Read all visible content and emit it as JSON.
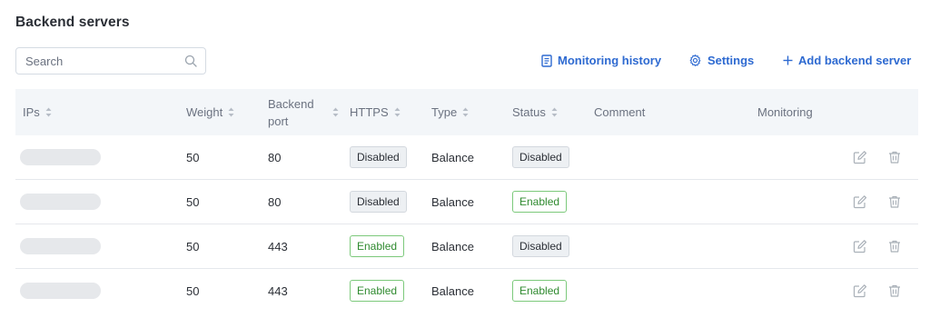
{
  "page": {
    "title": "Backend servers"
  },
  "search": {
    "placeholder": "Search",
    "value": ""
  },
  "toolbar": {
    "monitoring_history_label": "Monitoring history",
    "settings_label": "Settings",
    "add_server_label": "Add backend server"
  },
  "table": {
    "headers": {
      "ips": "IPs",
      "weight": "Weight",
      "backend_port_line1": "Backend",
      "backend_port_line2": "port",
      "https": "HTTPS",
      "type": "Type",
      "status": "Status",
      "comment": "Comment",
      "monitoring": "Monitoring"
    },
    "rows": [
      {
        "weight": "50",
        "port": "80",
        "https": "Disabled",
        "type": "Balance",
        "status": "Disabled",
        "comment": ""
      },
      {
        "weight": "50",
        "port": "80",
        "https": "Disabled",
        "type": "Balance",
        "status": "Enabled",
        "comment": ""
      },
      {
        "weight": "50",
        "port": "443",
        "https": "Enabled",
        "type": "Balance",
        "status": "Disabled",
        "comment": ""
      },
      {
        "weight": "50",
        "port": "443",
        "https": "Enabled",
        "type": "Balance",
        "status": "Enabled",
        "comment": ""
      }
    ]
  },
  "colors": {
    "accent": "#2e6ad1",
    "header_bg": "#f3f6f9",
    "enabled_border": "#7cc97b",
    "enabled_text": "#2f8a2f",
    "disabled_bg": "#edf0f3"
  },
  "icons": {
    "search": "search-icon",
    "history": "document-icon",
    "settings": "gear-icon",
    "add": "plus-icon",
    "edit": "edit-icon",
    "delete": "trash-icon",
    "sort": "sort-icon"
  }
}
